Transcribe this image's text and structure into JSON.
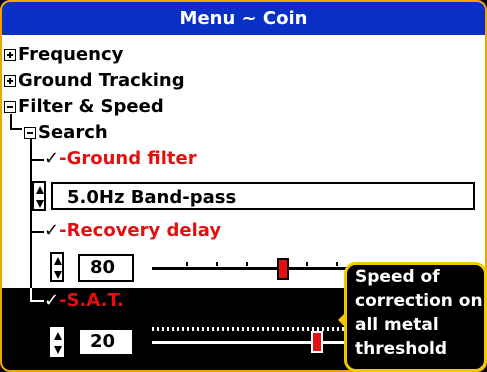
{
  "title": "Menu ~ Coin",
  "tree": {
    "frequency": "Frequency",
    "ground_tracking": "Ground Tracking",
    "filter_speed": "Filter & Speed",
    "search": "Search"
  },
  "settings": {
    "ground_filter": {
      "label": "Ground filter",
      "value": "5.0Hz Band-pass"
    },
    "recovery_delay": {
      "label": "Recovery delay",
      "value": "80",
      "slider_level": 0.5
    },
    "sat": {
      "label": "S.A.T.",
      "value": "20",
      "slider_level": 0.64
    }
  },
  "tooltip": "Speed of correction on all metal threshold",
  "colors": {
    "title_bg": "#0a2fc6",
    "accent": "#f0a400",
    "label_red": "#e41010",
    "tooltip_border": "#f0c800"
  },
  "icons": {
    "expand": "plus-box-icon",
    "collapse": "minus-box-icon",
    "check": "checkmark-icon"
  }
}
